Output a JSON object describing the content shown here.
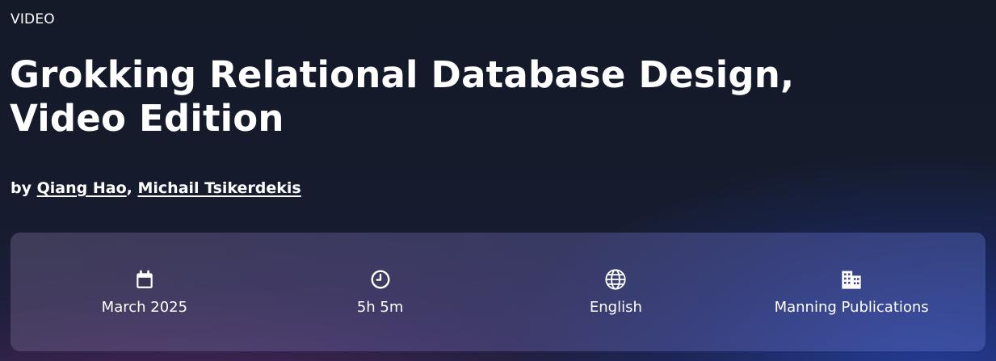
{
  "kicker": "VIDEO",
  "title": "Grokking Relational Database Design, Video Edition",
  "byline": {
    "prefix": "by",
    "authors": [
      "Qiang Hao",
      "Michail Tsikerdekis"
    ],
    "separator": ","
  },
  "meta": {
    "date": {
      "icon": "calendar-icon",
      "label": "March 2025"
    },
    "duration": {
      "icon": "clock-icon",
      "label": "5h 5m"
    },
    "language": {
      "icon": "globe-icon",
      "label": "English"
    },
    "publisher": {
      "icon": "building-icon",
      "label": "Manning Publications"
    }
  }
}
